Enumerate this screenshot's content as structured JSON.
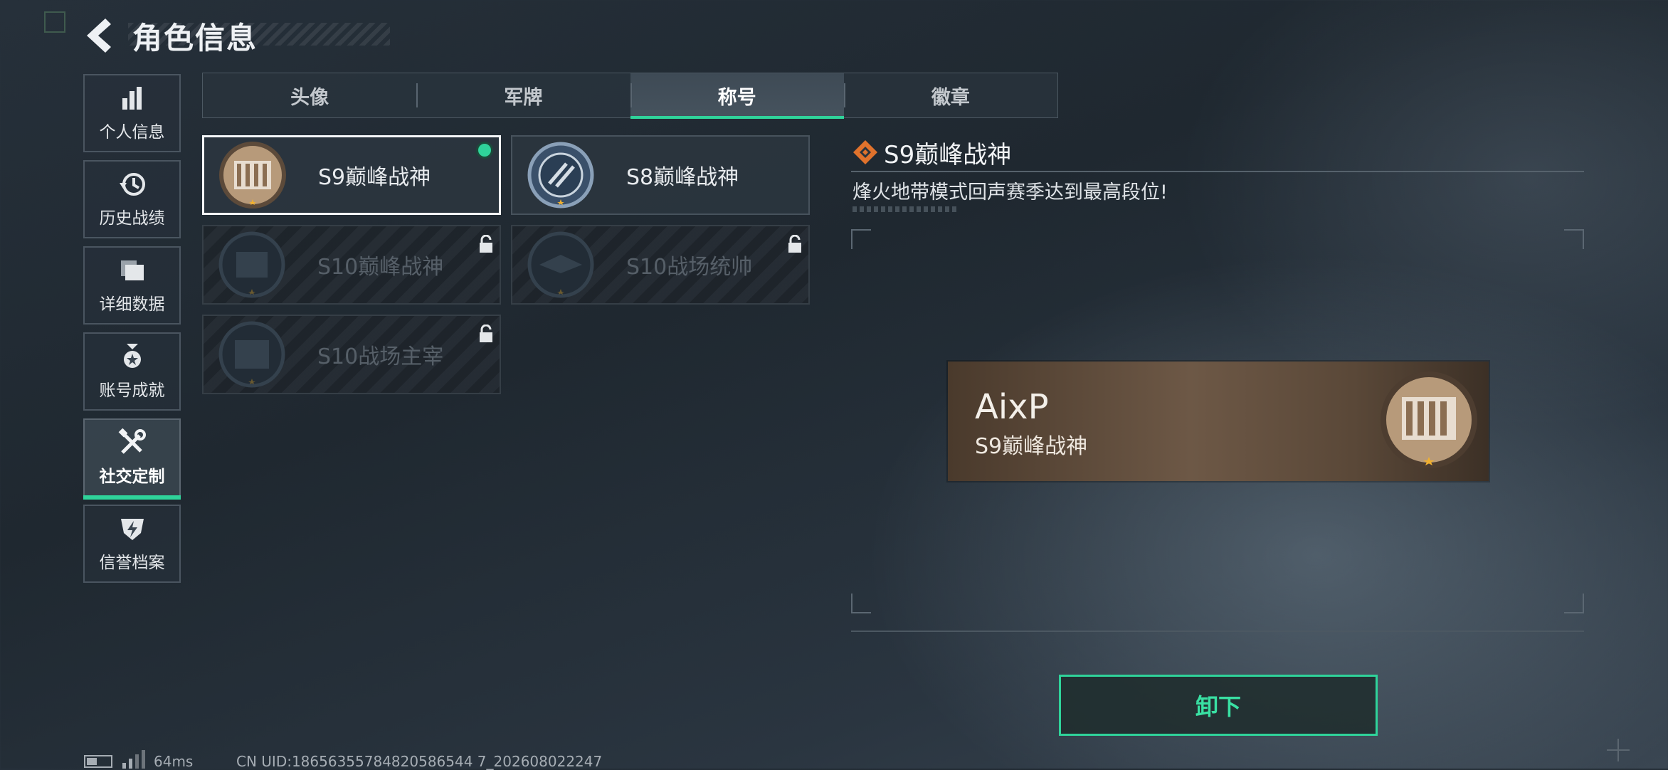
{
  "header": {
    "title": "角色信息"
  },
  "sidebar": {
    "items": [
      {
        "label": "个人信息",
        "icon": "bar-chart-icon"
      },
      {
        "label": "历史战绩",
        "icon": "history-clock-icon"
      },
      {
        "label": "详细数据",
        "icon": "folder-icon"
      },
      {
        "label": "账号成就",
        "icon": "medal-icon"
      },
      {
        "label": "社交定制",
        "icon": "tools-icon",
        "active": true
      },
      {
        "label": "信誉档案",
        "icon": "shield-bolt-icon"
      }
    ]
  },
  "tabs": [
    {
      "label": "头像"
    },
    {
      "label": "军牌"
    },
    {
      "label": "称号",
      "active": true
    },
    {
      "label": "徽章"
    }
  ],
  "titles": [
    {
      "name": "S9巅峰战神",
      "state": "selected-equipped"
    },
    {
      "name": "S8巅峰战神",
      "state": "owned"
    },
    {
      "name": "S10巅峰战神",
      "state": "locked"
    },
    {
      "name": "S10战场统帅",
      "state": "locked"
    },
    {
      "name": "S10战场主宰",
      "state": "locked"
    }
  ],
  "detail": {
    "title": "S9巅峰战神",
    "description": "烽火地带模式回声赛季达到最高段位!",
    "preview": {
      "player_name": "AixP",
      "title": "S9巅峰战神"
    },
    "action_label": "卸下"
  },
  "footer": {
    "ping": "64ms",
    "uid": "CN UID:18656355784820586544 7_202608022247"
  },
  "colors": {
    "accent": "#2fd39a",
    "preview_bg": "#6d5846"
  }
}
